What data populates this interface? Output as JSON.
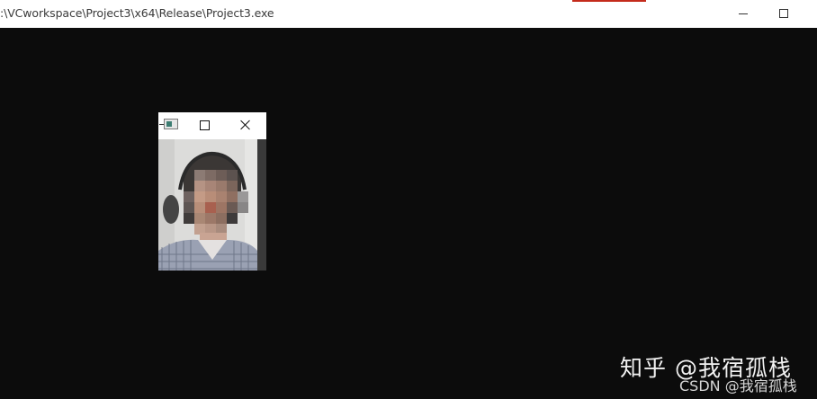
{
  "window": {
    "title": ":\\VCworkspace\\Project3\\x64\\Release\\Project3.exe",
    "background_color": "#0c0c0c",
    "titlebar_color": "#ffffff"
  },
  "preview_window": {
    "icon": "app-icon",
    "video_content": "pixelated webcam frame of a person"
  },
  "watermarks": {
    "zhihu": "知乎 @我宿孤栈",
    "csdn": "CSDN @我宿孤栈"
  },
  "icons": {
    "minimize": "minimize-icon",
    "maximize": "maximize-icon",
    "close": "close-icon"
  }
}
